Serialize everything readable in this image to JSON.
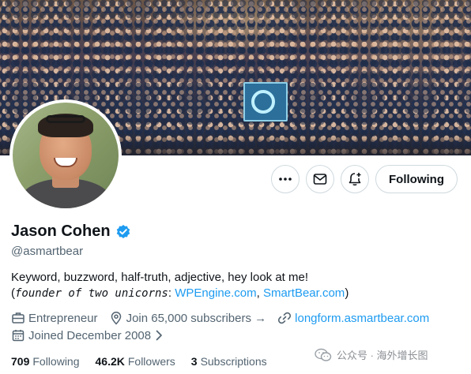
{
  "profile": {
    "name": "Jason Cohen",
    "handle": "@asmartbear",
    "verified": true,
    "bio_line1": "Keyword, buzzword, half-truth, adjective, hey look at me!",
    "bio_open_paren": "(",
    "bio_italic": "founder of two unicorns",
    "bio_colon": ": ",
    "bio_link1": "WPEngine.com",
    "bio_comma": ", ",
    "bio_link2": "SmartBear.com",
    "bio_close_paren": ")",
    "category": "Entrepreneur",
    "location_text": "Join 65,000 subscribers →",
    "website": "longform.asmartbear.com",
    "joined": "Joined December 2008"
  },
  "actions": {
    "following_label": "Following"
  },
  "stats": {
    "following_count": "709",
    "following_label": "Following",
    "followers_count": "46.2K",
    "followers_label": "Followers",
    "subscriptions_count": "3",
    "subscriptions_label": "Subscriptions"
  },
  "watermark": {
    "text": "公众号 · 海外增长图"
  },
  "colors": {
    "link": "#1d9bf0",
    "verified": "#1d9bf0",
    "secondary_text": "#536471",
    "border": "#cfd9de"
  },
  "icons": [
    "more-icon",
    "mail-icon",
    "notification-add-icon",
    "verified-badge-icon",
    "briefcase-icon",
    "location-pin-icon",
    "link-icon",
    "calendar-icon",
    "chevron-right-icon",
    "wechat-icon"
  ]
}
